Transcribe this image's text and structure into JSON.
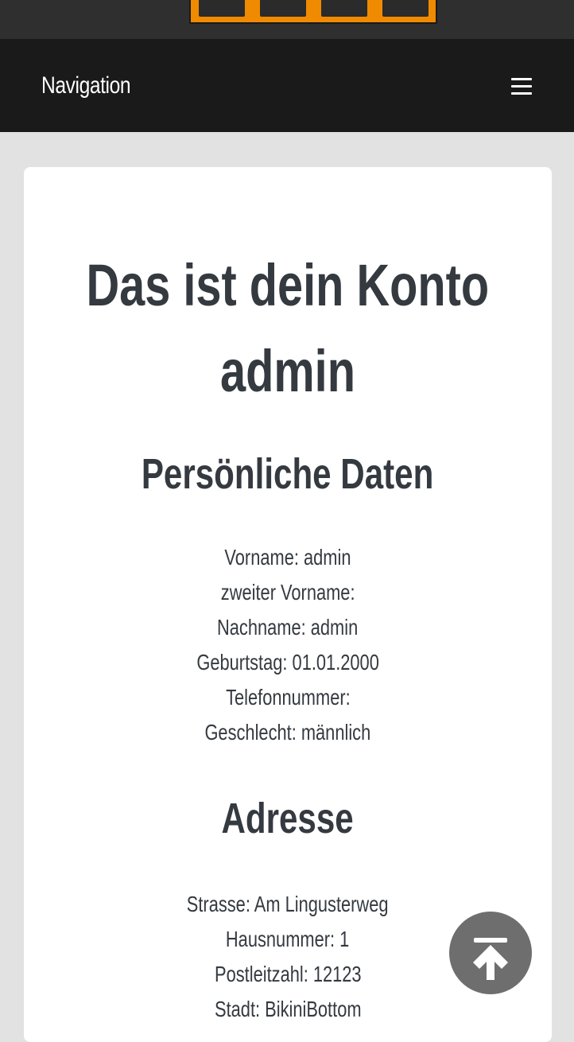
{
  "header": {
    "nav_title": "Navigation",
    "menu_icon": "hamburger-menu-icon"
  },
  "account": {
    "title_line1": "Das ist dein Konto",
    "title_line2": "admin",
    "personal": {
      "heading": "Persönliche Daten",
      "lines": [
        "Vorname: admin",
        "zweiter Vorname:",
        "Nachname: admin",
        "Geburtstag: 01.01.2000",
        "Telefonnummer:",
        "Geschlecht: männlich"
      ]
    },
    "address": {
      "heading": "Adresse",
      "lines": [
        "Strasse: Am Lingusterweg",
        "Hausnummer: 1",
        "Postleitzahl: 12123",
        "Stadt: BikiniBottom"
      ]
    }
  },
  "scroll_top_icon": "arrow-up-to-top-icon",
  "colors": {
    "logo_orange": "#f08a00",
    "navbar": "#1a1a1a",
    "text": "#343a40",
    "fab": "#6e6e6e"
  }
}
